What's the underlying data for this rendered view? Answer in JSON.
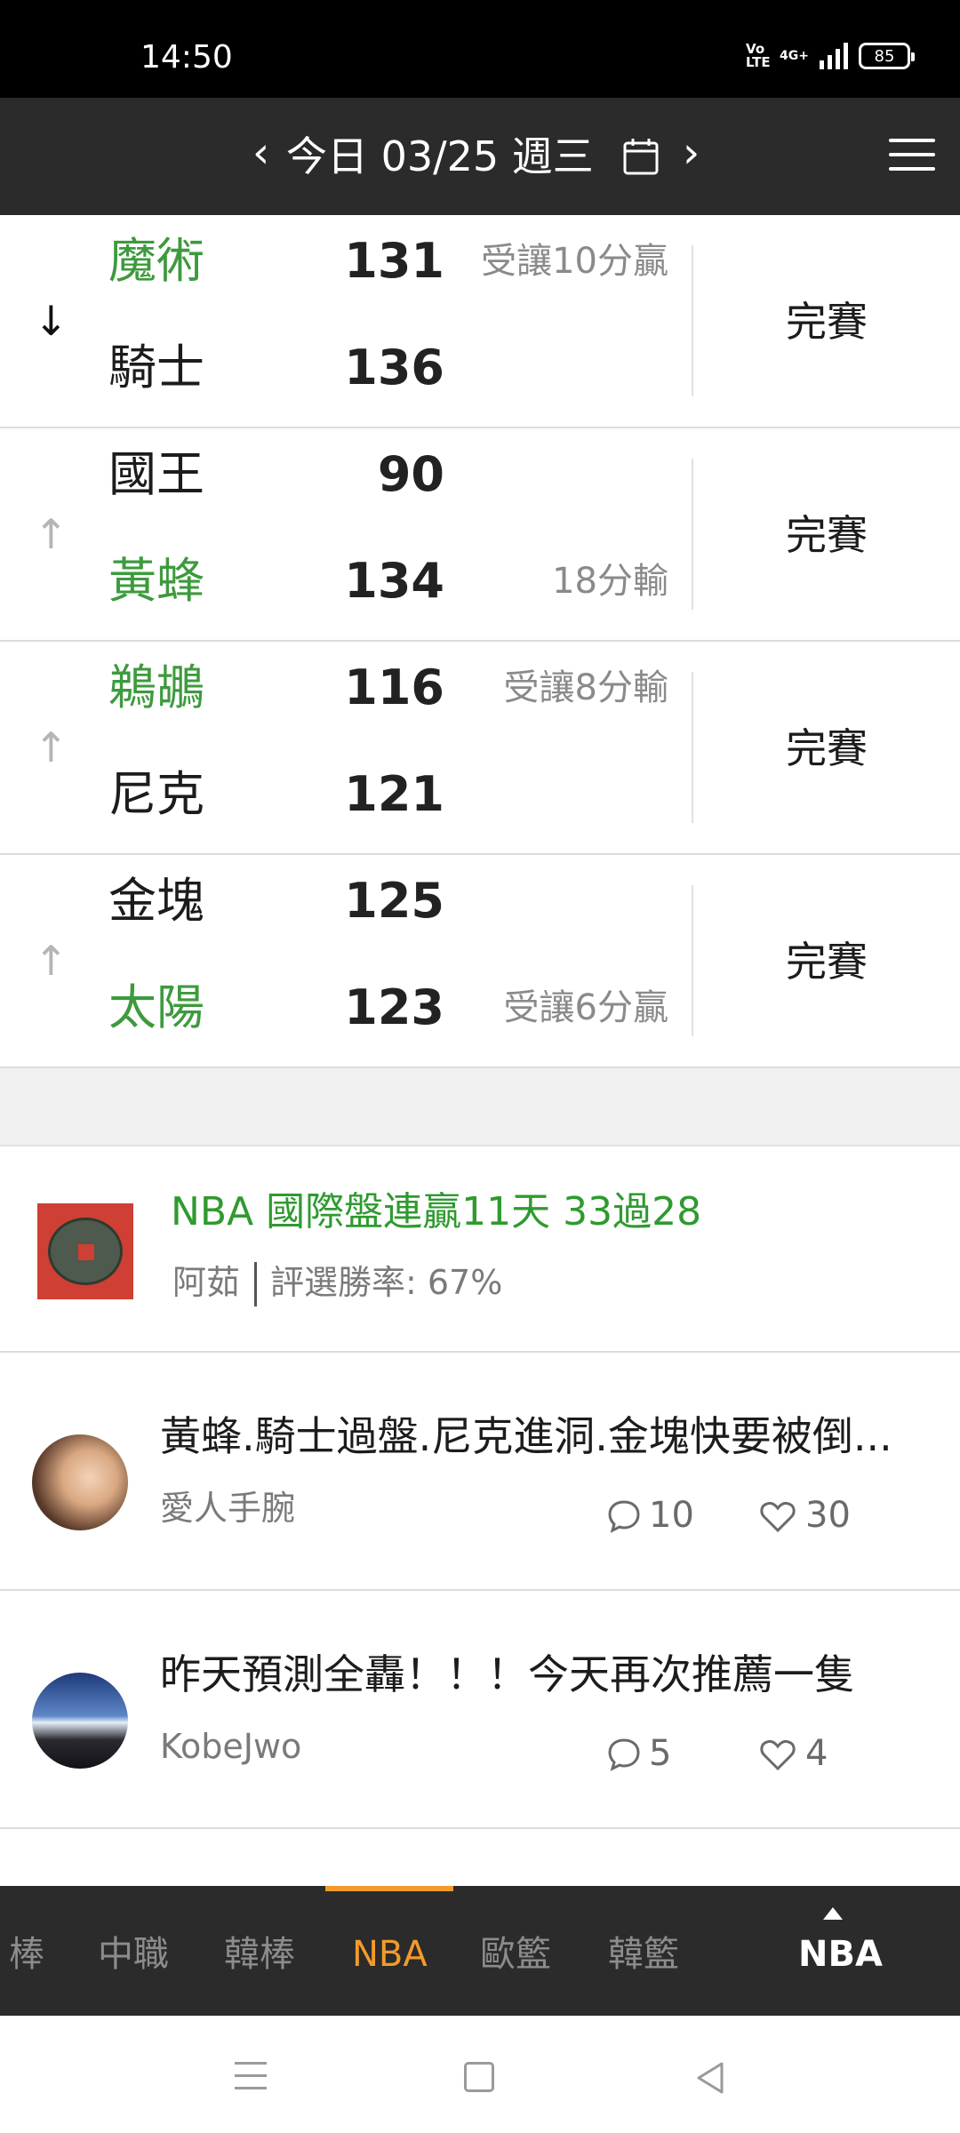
{
  "status_bar": {
    "time": "14:50",
    "volte_top": "Vo",
    "volte_bottom": "LTE",
    "network": "4G+",
    "battery": "85"
  },
  "header": {
    "prev_icon": "chevron-left-icon",
    "date_title": "今日 03/25 週三",
    "calendar_icon": "calendar-icon",
    "next_icon": "chevron-right-icon",
    "menu_icon": "hamburger-menu-icon"
  },
  "games": [
    {
      "arrow": "↓",
      "arrow_style": "down",
      "team1": {
        "name": "魔術",
        "score": "131",
        "color": "green",
        "note": "受讓10分贏"
      },
      "team2": {
        "name": "騎士",
        "score": "136",
        "color": "black",
        "note": ""
      },
      "status": "完賽"
    },
    {
      "arrow": "↑",
      "arrow_style": "up",
      "team1": {
        "name": "國王",
        "score": "90",
        "color": "black",
        "note": ""
      },
      "team2": {
        "name": "黃蜂",
        "score": "134",
        "color": "green",
        "note": "18分輸"
      },
      "status": "完賽"
    },
    {
      "arrow": "↑",
      "arrow_style": "up",
      "team1": {
        "name": "鵜鶘",
        "score": "116",
        "color": "green",
        "note": "受讓8分輸"
      },
      "team2": {
        "name": "尼克",
        "score": "121",
        "color": "black",
        "note": ""
      },
      "status": "完賽"
    },
    {
      "arrow": "↑",
      "arrow_style": "up",
      "team1": {
        "name": "金塊",
        "score": "125",
        "color": "black",
        "note": ""
      },
      "team2": {
        "name": "太陽",
        "score": "123",
        "color": "green",
        "note": "受讓6分贏"
      },
      "status": "完賽"
    }
  ],
  "featured_post": {
    "title": "NBA 國際盤連贏11天 33過28",
    "author": "阿茹",
    "win_rate": "評選勝率: 67%"
  },
  "posts": [
    {
      "title": "黃蜂.騎士過盤.尼克進洞.金塊快要被倒...",
      "author": "愛人手腕",
      "comments": "10",
      "likes": "30"
    },
    {
      "title": "昨天預測全轟！！！今天再次推薦一隻",
      "author": "KobeJwo",
      "comments": "5",
      "likes": "4"
    }
  ],
  "league_tabs": {
    "items": [
      "棒",
      "中職",
      "韓棒",
      "NBA",
      "歐籃",
      "韓籃"
    ],
    "active": "NBA",
    "current": "NBA"
  },
  "colors": {
    "accent": "#f29b2b",
    "team_green": "#3d9a3d",
    "header_bg": "#2b2b2b"
  }
}
